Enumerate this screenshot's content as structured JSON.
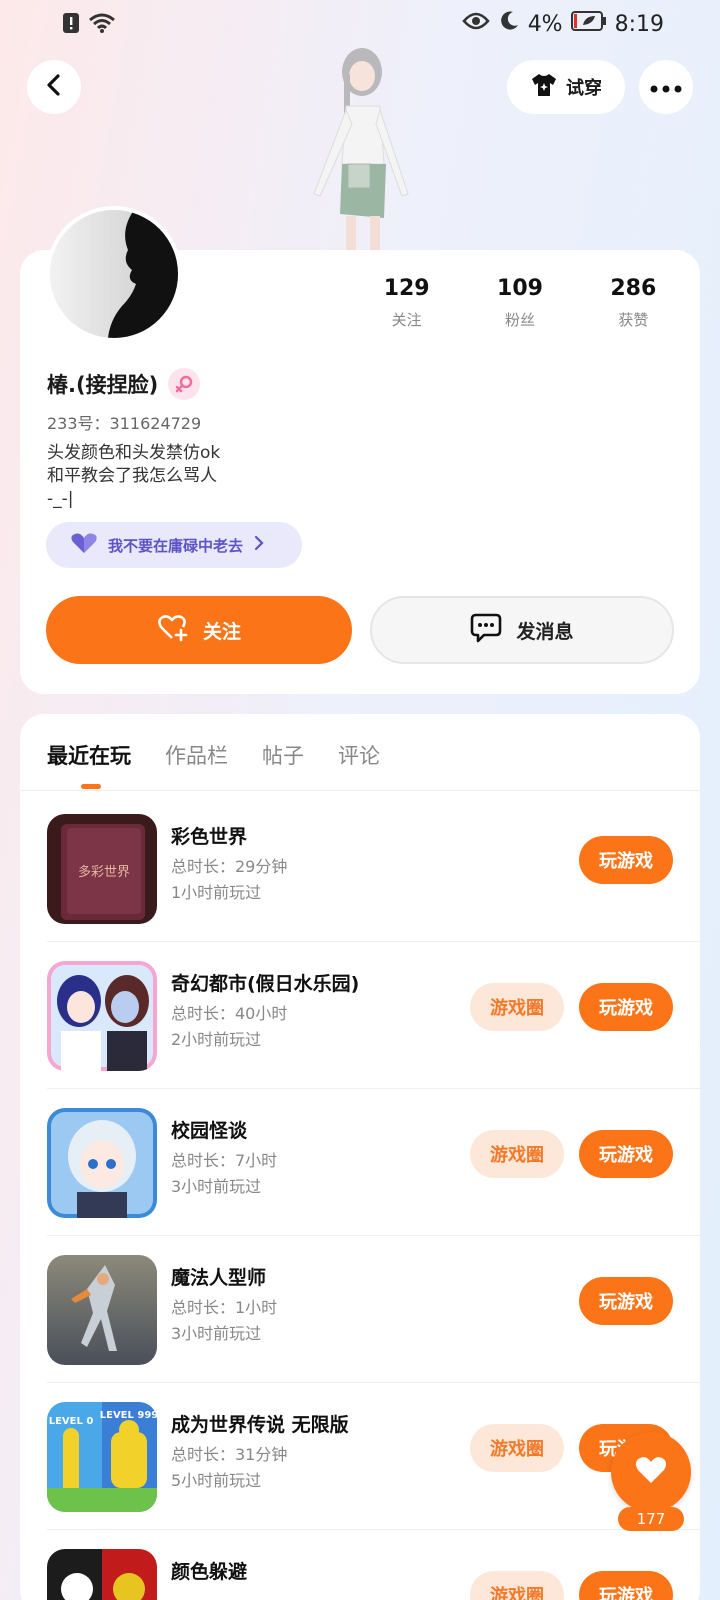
{
  "status_bar": {
    "battery": "4%",
    "time": "8:19"
  },
  "top_nav": {
    "tryon_label": "试穿"
  },
  "profile": {
    "name": "椿.(接捏脸)",
    "uid": "233号：311624729",
    "bio": "头发颜色和头发禁仿ok\n和平教会了我怎么骂人\n-_-|",
    "tag": "我不要在庸碌中老去",
    "stats": [
      {
        "num": "129",
        "label": "关注"
      },
      {
        "num": "109",
        "label": "粉丝"
      },
      {
        "num": "286",
        "label": "获赞"
      }
    ],
    "follow_label": "关注",
    "message_label": "发消息"
  },
  "tabs": [
    "最近在玩",
    "作品栏",
    "帖子",
    "评论"
  ],
  "games": [
    {
      "title": "彩色世界",
      "duration": "总时长：29分钟",
      "last_played": "1小时前玩过",
      "has_circle": false,
      "icon_text": "多彩世界"
    },
    {
      "title": "奇幻都市(假日水乐园)",
      "duration": "总时长：40小时",
      "last_played": "2小时前玩过",
      "has_circle": true
    },
    {
      "title": "校园怪谈",
      "duration": "总时长：7小时",
      "last_played": "3小时前玩过",
      "has_circle": true
    },
    {
      "title": "魔法人型师",
      "duration": "总时长：1小时",
      "last_played": "3小时前玩过",
      "has_circle": false
    },
    {
      "title": "成为世界传说 无限版",
      "duration": "总时长：31分钟",
      "last_played": "5小时前玩过",
      "has_circle": true,
      "icon_text_1": "LEVEL 0",
      "icon_text_2": "LEVEL 999"
    },
    {
      "title": "颜色躲避",
      "duration": "",
      "last_played": "",
      "has_circle": true
    }
  ],
  "buttons": {
    "play": "玩游戏",
    "circle": "游戏圈"
  },
  "like_count": "177"
}
